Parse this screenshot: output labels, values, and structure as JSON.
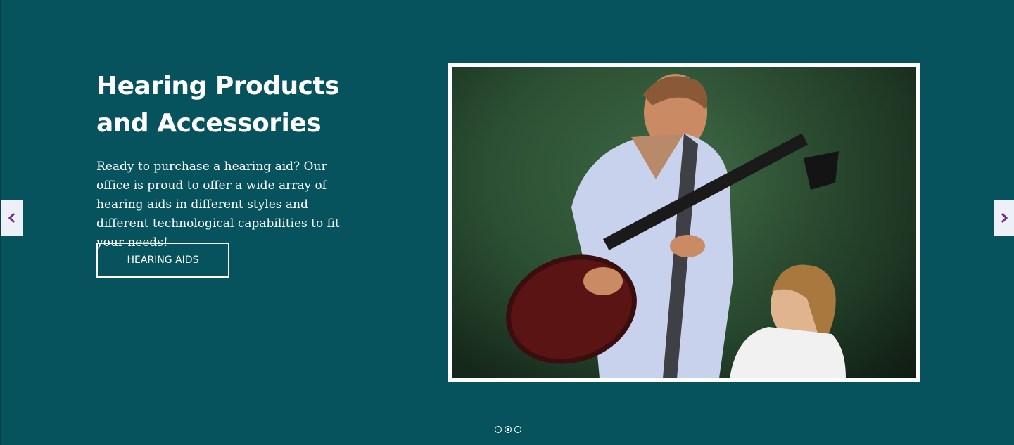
{
  "hero": {
    "heading_line1": "Hearing Products",
    "heading_line2": "and Accessories",
    "description": "Ready to purchase a hearing aid? Our office is proud to offer a wide array of hearing aids in different styles and different technological capabilities to fit your needs!",
    "cta_label": "HEARING AIDS"
  },
  "carousel": {
    "prev_icon": "chevron-left-icon",
    "next_icon": "chevron-right-icon",
    "slide_count": 3,
    "active_slide": 2
  },
  "colors": {
    "background": "#06525d",
    "arrow_bg": "#eef0f7",
    "arrow_icon": "#6b2a8c",
    "text": "#ffffff"
  }
}
